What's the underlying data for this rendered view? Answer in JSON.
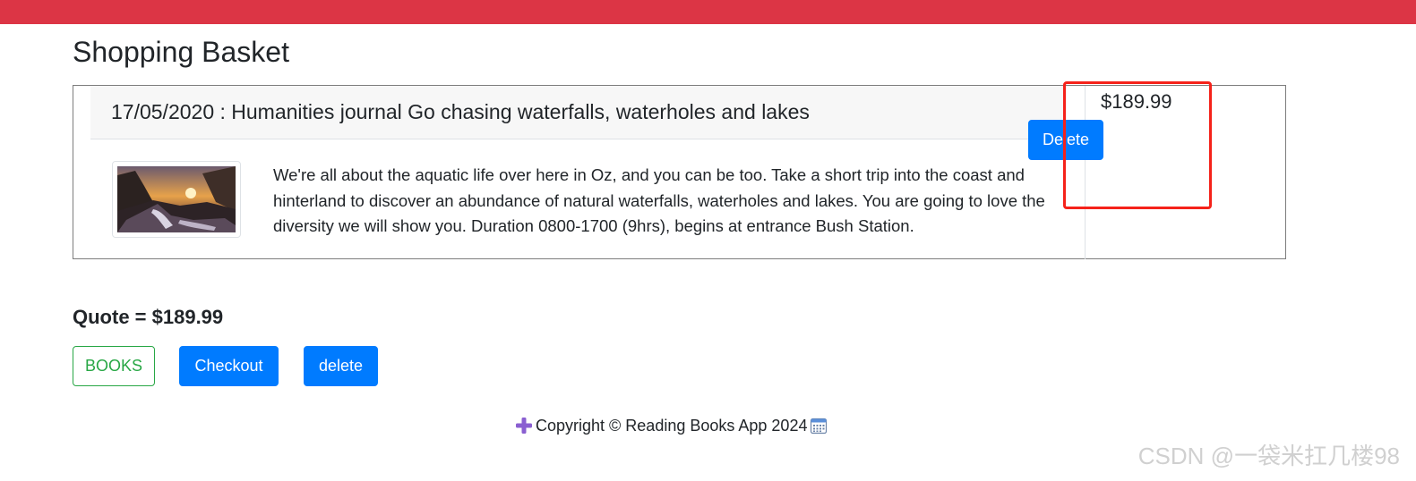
{
  "page": {
    "title": "Shopping Basket"
  },
  "cart": {
    "items": [
      {
        "heading": "17/05/2020 : Humanities journal Go chasing waterfalls, waterholes and lakes",
        "description": "We're all about the aquatic life over here in Oz, and you can be too. Take a short trip into the coast and hinterland to discover an abundance of natural waterfalls, waterholes and lakes. You are going to love the diversity we will show you. Duration 0800-1700 (9hrs), begins at entrance Bush Station.",
        "price": "$189.99",
        "delete_label": "Delete",
        "image_icon": "waterfall-photo"
      }
    ]
  },
  "summary": {
    "quote": "Quote = $189.99"
  },
  "actions": {
    "books_label": "BOOKS",
    "checkout_label": "Checkout",
    "delete_label": "delete"
  },
  "footer": {
    "copyright": "Copyright © Reading Books App 2024",
    "left_icon": "plus-icon",
    "right_icon": "calendar-icon"
  },
  "watermark": {
    "text": "CSDN @一袋米扛几楼98"
  },
  "colors": {
    "top_bar": "#dc3545",
    "primary": "#007bff",
    "success": "#28a745",
    "highlight": "#f5221a"
  }
}
